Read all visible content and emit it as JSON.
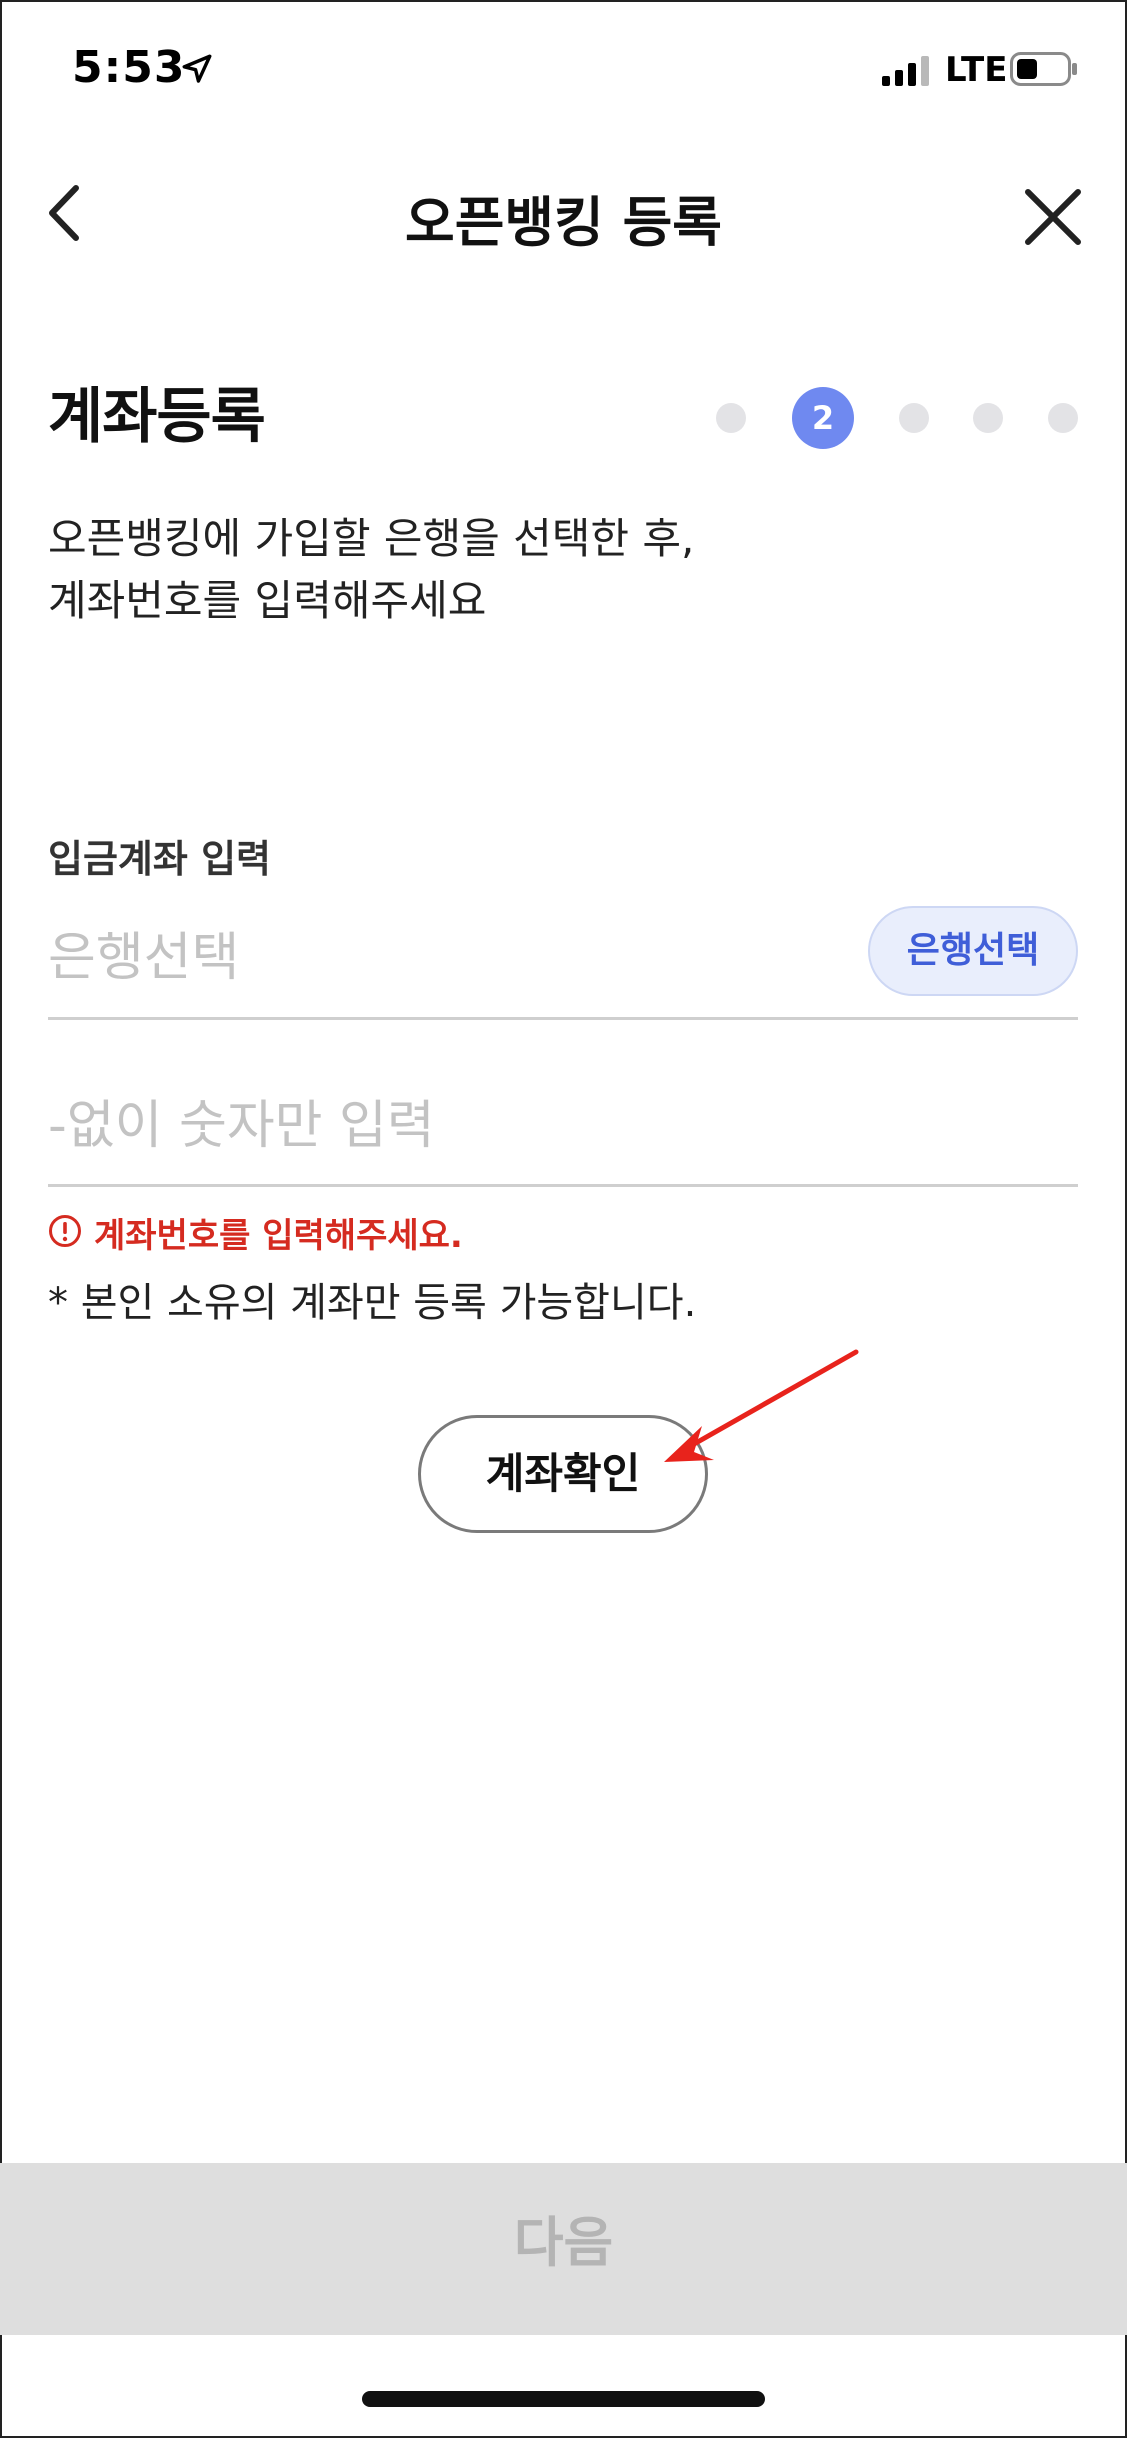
{
  "status_bar": {
    "time": "5:53",
    "network": "LTE",
    "icons": [
      "location-arrow-icon",
      "signal-bars-icon",
      "battery-icon"
    ]
  },
  "nav": {
    "title": "오픈뱅킹 등록",
    "back_icon": "chevron-left-icon",
    "close_icon": "close-icon"
  },
  "section": {
    "title": "계좌등록",
    "steps_total": 5,
    "current_step": "2",
    "desc_line1": "오픈뱅킹에 가입할 은행을 선택한 후,",
    "desc_line2": "계좌번호를 입력해주세요"
  },
  "form": {
    "label": "입금계좌 입력",
    "bank_placeholder": "은행선택",
    "bank_button": "은행선택",
    "account_placeholder": "-없이 숫자만 입력",
    "error": "계좌번호를 입력해주세요.",
    "note": "* 본인 소유의 계좌만 등록 가능합니다.",
    "confirm_button": "계좌확인"
  },
  "bottom": {
    "next_button": "다음"
  },
  "colors": {
    "accent": "#6f89f0",
    "bank_button_text": "#3f5ed8",
    "error": "#d52b20",
    "arrow": "#e8231c",
    "disabled_bar": "#dedede"
  }
}
